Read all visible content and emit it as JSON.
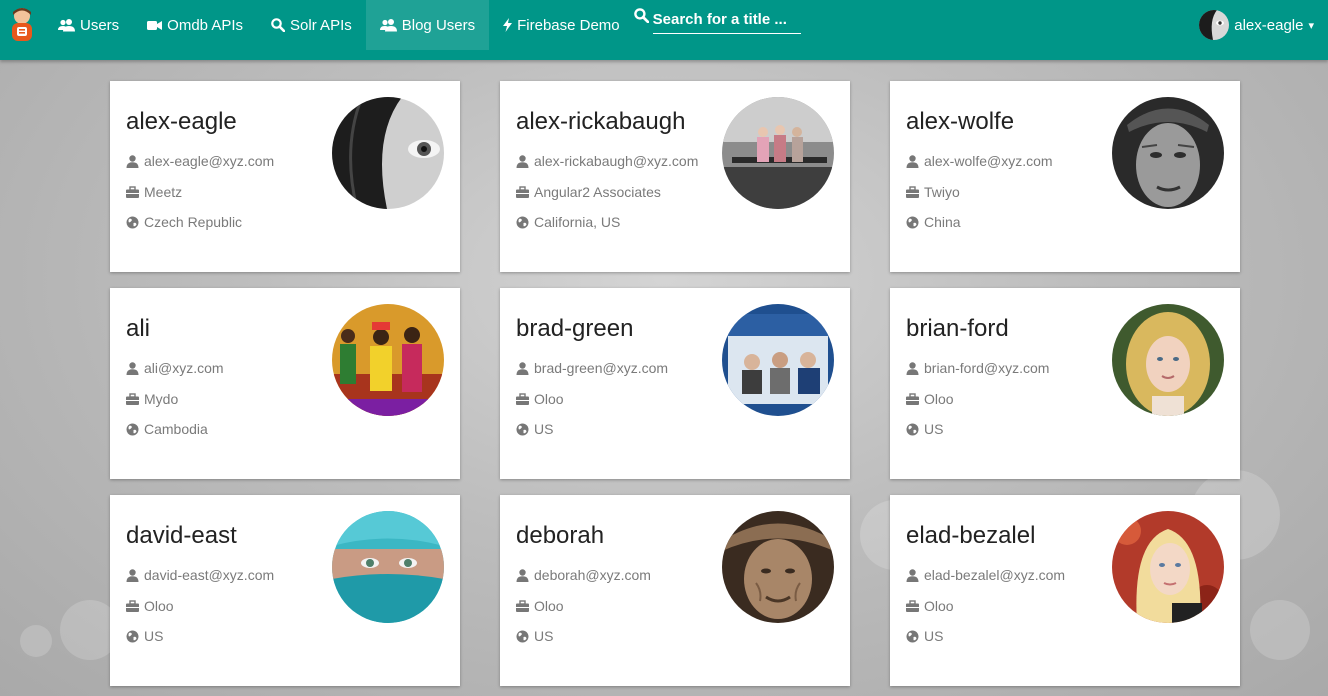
{
  "nav": {
    "brand_icon": "blogger-avatar-icon",
    "items": [
      {
        "label": "Users",
        "icon": "users-icon"
      },
      {
        "label": "Omdb APIs",
        "icon": "video-camera-icon"
      },
      {
        "label": "Solr APIs",
        "icon": "search-icon"
      },
      {
        "label": "Blog Users",
        "icon": "users-icon"
      },
      {
        "label": "Firebase Demo",
        "icon": "bolt-icon"
      }
    ],
    "active_item": "Blog Users",
    "search": {
      "placeholder": "Search for a title ...",
      "value": ""
    },
    "user": {
      "name": "alex-eagle",
      "caret": "▾"
    }
  },
  "colors": {
    "navbar": "#009688",
    "card": "#ffffff",
    "name_text": "#222222",
    "meta_text": "#7a7a7a"
  },
  "users": [
    {
      "name": "alex-eagle",
      "email": "alex-eagle@xyz.com",
      "company": "Meetz",
      "location": "Czech Republic"
    },
    {
      "name": "alex-rickabaugh",
      "email": "alex-rickabaugh@xyz.com",
      "company": "Angular2 Associates",
      "location": "California, US"
    },
    {
      "name": "alex-wolfe",
      "email": "alex-wolfe@xyz.com",
      "company": "Twiyo",
      "location": "China"
    },
    {
      "name": "ali",
      "email": "ali@xyz.com",
      "company": "Mydo",
      "location": "Cambodia"
    },
    {
      "name": "brad-green",
      "email": "brad-green@xyz.com",
      "company": "Oloo",
      "location": "US"
    },
    {
      "name": "brian-ford",
      "email": "brian-ford@xyz.com",
      "company": "Oloo",
      "location": "US"
    },
    {
      "name": "david-east",
      "email": "david-east@xyz.com",
      "company": "Oloo",
      "location": "US"
    },
    {
      "name": "deborah",
      "email": "deborah@xyz.com",
      "company": "Oloo",
      "location": "US"
    },
    {
      "name": "elad-bezalel",
      "email": "elad-bezalel@xyz.com",
      "company": "Oloo",
      "location": "US"
    }
  ]
}
